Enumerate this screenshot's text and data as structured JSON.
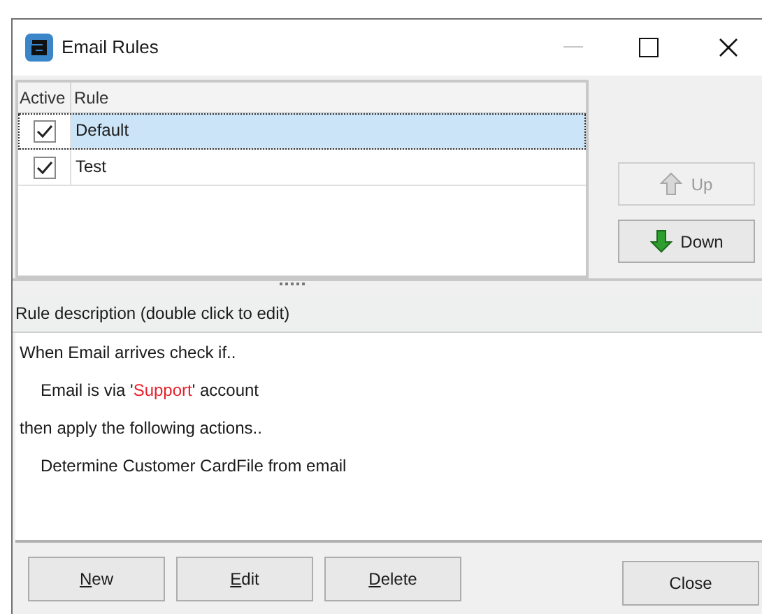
{
  "window": {
    "title": "Email Rules"
  },
  "table": {
    "columns": [
      "Active",
      "Rule"
    ],
    "rows": [
      {
        "active": true,
        "rule": "Default",
        "selected": true
      },
      {
        "active": true,
        "rule": "Test",
        "selected": false
      }
    ]
  },
  "side_buttons": [
    {
      "label": "Up",
      "kind": "up",
      "disabled": true
    },
    {
      "label": "Down",
      "kind": "down",
      "disabled": false
    }
  ],
  "description": {
    "header": "Rule description (double click to edit)",
    "lines": [
      {
        "indented": false,
        "parts": [
          {
            "text": "When Email arrives check if..",
            "highlight": false
          }
        ]
      },
      {
        "indented": true,
        "parts": [
          {
            "text": "Email is via '",
            "highlight": false
          },
          {
            "text": "Support",
            "highlight": true
          },
          {
            "text": "' account",
            "highlight": false
          }
        ]
      },
      {
        "indented": false,
        "parts": [
          {
            "text": "then apply the following actions..",
            "highlight": false
          }
        ]
      },
      {
        "indented": true,
        "parts": [
          {
            "text": "Determine Customer CardFile from email",
            "highlight": false
          }
        ]
      }
    ]
  },
  "buttons": [
    {
      "label": "New",
      "underline_first": true
    },
    {
      "label": "Edit",
      "underline_first": true
    },
    {
      "label": "Delete",
      "underline_first": true
    }
  ],
  "close_button": {
    "label": "Close"
  }
}
